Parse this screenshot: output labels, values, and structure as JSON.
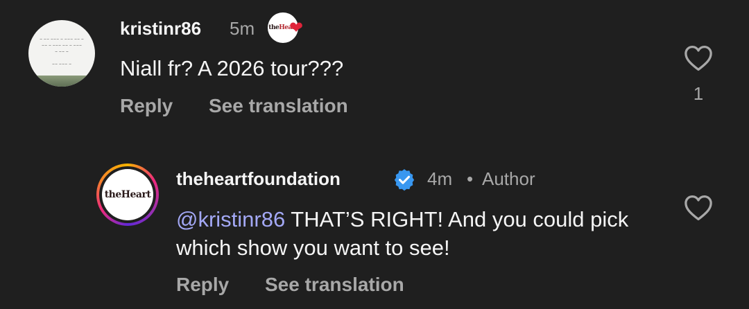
{
  "comments": [
    {
      "username": "kristinr86",
      "time": "5m",
      "text": "Niall fr? A 2026 tour???",
      "reply_label": "Reply",
      "translate_label": "See translation",
      "like_count": "1",
      "avatar_icon": "handwritten-note-avatar",
      "badge_icon": "heart-foundation-sticker"
    },
    {
      "username": "theheartfoundation",
      "time": "4m",
      "separator": "•",
      "role": "Author",
      "mention": "@kristinr86",
      "text": " THAT’S RIGHT! And you could pick which show you want to see!",
      "reply_label": "Reply",
      "translate_label": "See translation",
      "verified_icon": "verified-badge-icon",
      "avatar_icon": "heart-foundation-logo-avatar",
      "logo_text": "theHeart"
    }
  ],
  "colors": {
    "background": "#1f1f1f",
    "primary_text": "#f5f5f5",
    "secondary_text": "#a8a8a8",
    "mention": "#a3a8f5",
    "verified": "#3897f0"
  }
}
